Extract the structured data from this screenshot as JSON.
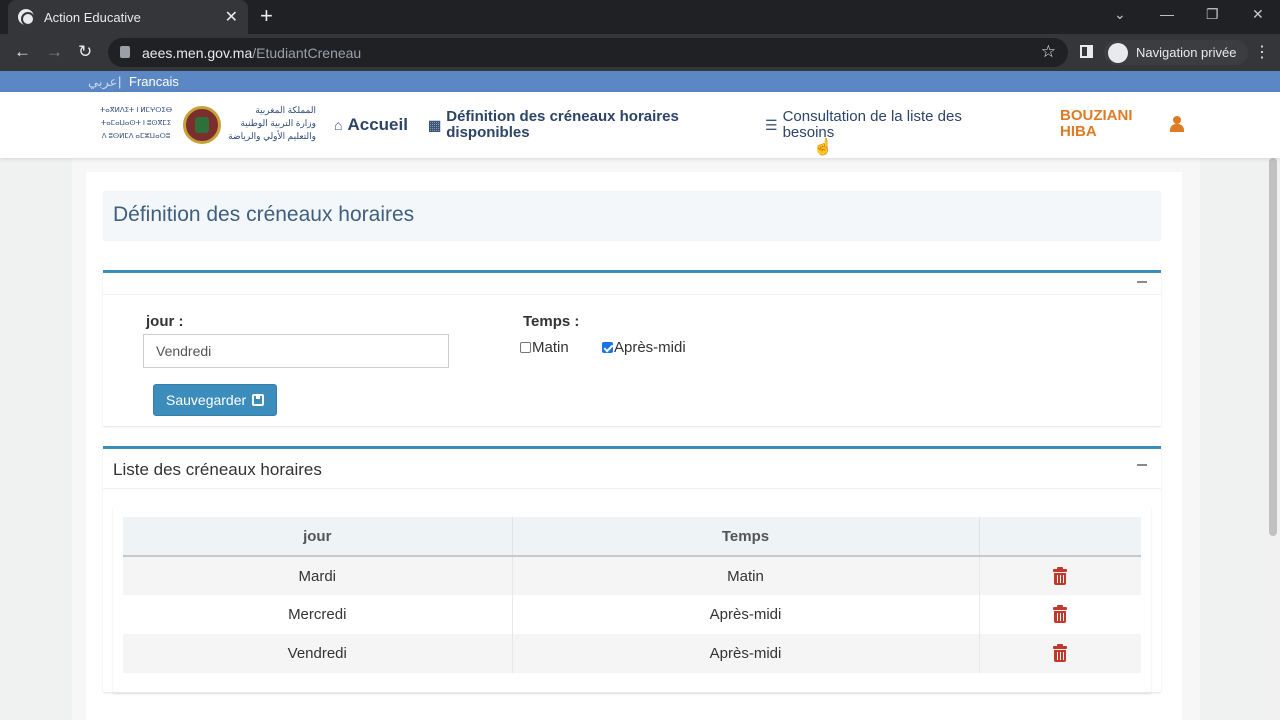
{
  "browser": {
    "tab_title": "Action Educative",
    "url_domain": "aees.men.gov.ma",
    "url_path": "/EtudiantCreneau",
    "profile_label": "Navigation privée"
  },
  "lang": {
    "arabic": "عربي",
    "separator": "|",
    "french": "Francais"
  },
  "logo": {
    "tifinagh": [
      "ⵜⴰⴳⵍⴷⵉⵜ ⵏ ⵍⵎⵖⵔⵉⴱ",
      "ⵜⴰⵎⴰⵡⴰⵙⵜ ⵏ ⵓⵙⴳⵎⵉ",
      "ⴷ ⵓⵙⵍⵎⴷ ⴰⵎⵣⵡⴰⵔⵓ"
    ],
    "arabic": [
      "المملكة المغربية",
      "وزارة التربية الوطنية",
      "والتعليم الأولي والرياضة"
    ]
  },
  "nav": {
    "accueil": "Accueil",
    "creneaux": "Définition des créneaux horaires disponibles",
    "besoins": "Consultation de la liste des besoins",
    "user_name": "BOUZIANI HIBA"
  },
  "page": {
    "title": "Définition des créneaux horaires"
  },
  "form": {
    "jour_label": "jour :",
    "jour_value": "Vendredi",
    "temps_label": "Temps :",
    "matin_label": "Matin",
    "matin_checked": false,
    "apres_midi_label": "Après-midi",
    "apres_midi_checked": true,
    "save_label": "Sauvegarder"
  },
  "list": {
    "title": "Liste des créneaux horaires",
    "columns": [
      "jour",
      "Temps",
      ""
    ],
    "rows": [
      {
        "jour": "Mardi",
        "temps": "Matin"
      },
      {
        "jour": "Mercredi",
        "temps": "Après-midi"
      },
      {
        "jour": "Vendredi",
        "temps": "Après-midi"
      }
    ]
  },
  "colors": {
    "accent": "#3c8dbc",
    "user": "#e07b25",
    "delete": "#c0392b",
    "lang_bar": "#5b87c4"
  }
}
